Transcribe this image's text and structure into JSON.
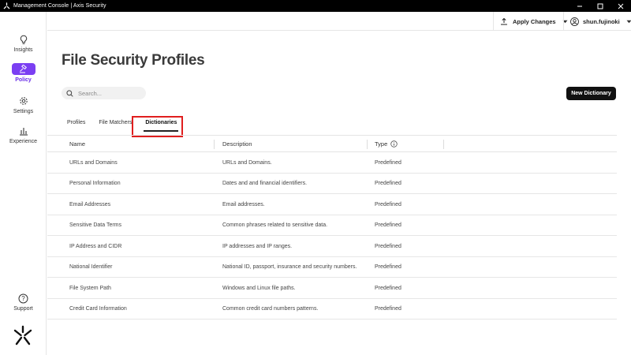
{
  "window": {
    "title": "Management Console | Axis Security"
  },
  "sidebar": {
    "items": [
      {
        "label": "Insights",
        "icon": "lightbulb-icon"
      },
      {
        "label": "Policy",
        "icon": "gavel-icon",
        "active": true
      },
      {
        "label": "Settings",
        "icon": "gear-icon"
      },
      {
        "label": "Experience",
        "icon": "bar-chart-icon"
      }
    ],
    "support_label": "Support",
    "accent_color": "#7b3ff2"
  },
  "header": {
    "apply_label": "Apply Changes",
    "username": "shun.fujinoki"
  },
  "main": {
    "title": "File Security Profiles",
    "search_placeholder": "Search...",
    "new_button": "New Dictionary",
    "tabs": [
      {
        "label": "Profiles"
      },
      {
        "label": "File Matchers"
      },
      {
        "label": "Dictionaries",
        "active": true
      }
    ],
    "table": {
      "columns": [
        "Name",
        "Description",
        "Type"
      ],
      "rows": [
        {
          "name": "URLs and Domains",
          "description": "URLs and Domains.",
          "type": "Predefined"
        },
        {
          "name": "Personal Information",
          "description": "Dates and and financial identifiers.",
          "type": "Predefined"
        },
        {
          "name": "Email Addresses",
          "description": "Email addresses.",
          "type": "Predefined"
        },
        {
          "name": "Sensitive Data Terms",
          "description": "Common phrases related to sensitive data.",
          "type": "Predefined"
        },
        {
          "name": "IP Address and CIDR",
          "description": "IP addresses and IP ranges.",
          "type": "Predefined"
        },
        {
          "name": "National Identifier",
          "description": "National ID, passport, insurance and security numbers.",
          "type": "Predefined"
        },
        {
          "name": "File System Path",
          "description": "Windows and Linux file paths.",
          "type": "Predefined"
        },
        {
          "name": "Credit Card Information",
          "description": "Common credit card numbers patterns.",
          "type": "Predefined"
        }
      ]
    }
  }
}
